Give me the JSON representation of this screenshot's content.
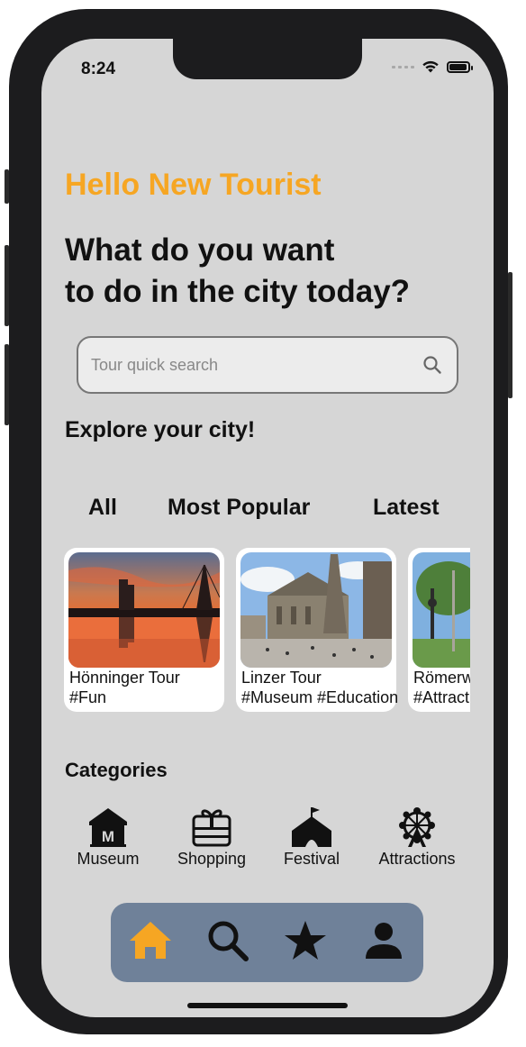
{
  "status_bar": {
    "time": "8:24",
    "icons": [
      "signal-dots-icon",
      "wifi-icon",
      "battery-icon"
    ]
  },
  "greeting": "Hello New Tourist",
  "headline": {
    "line1": "What do you want",
    "line2": "to do in the city today?"
  },
  "search": {
    "placeholder": "Tour quick search",
    "value": "",
    "icon": "search-icon"
  },
  "explore_title": "Explore your city!",
  "tabs": [
    {
      "label": "All"
    },
    {
      "label": "Most Popular"
    },
    {
      "label": "Latest"
    }
  ],
  "tours": [
    {
      "title": "Hönninger Tour",
      "tags": "#Fun"
    },
    {
      "title": "Linzer Tour",
      "tags": "#Museum #Education"
    },
    {
      "title": "Römerweg",
      "tags": "#Attractions"
    }
  ],
  "categories_title": "Categories",
  "categories": [
    {
      "label": "Museum",
      "icon": "museum-icon"
    },
    {
      "label": "Shopping",
      "icon": "gift-card-icon"
    },
    {
      "label": "Festival",
      "icon": "festival-tent-icon"
    },
    {
      "label": "Attractions",
      "icon": "ferris-wheel-icon"
    }
  ],
  "tab_bar": [
    {
      "name": "home",
      "icon": "home-icon",
      "active": true
    },
    {
      "name": "search",
      "icon": "search-icon"
    },
    {
      "name": "favorites",
      "icon": "star-icon"
    },
    {
      "name": "profile",
      "icon": "person-icon"
    }
  ],
  "colors": {
    "accent": "#f6a623",
    "screen_bg": "#d6d6d6",
    "tab_bar_bg": "#6f8199",
    "card_bg": "#ffffff"
  }
}
